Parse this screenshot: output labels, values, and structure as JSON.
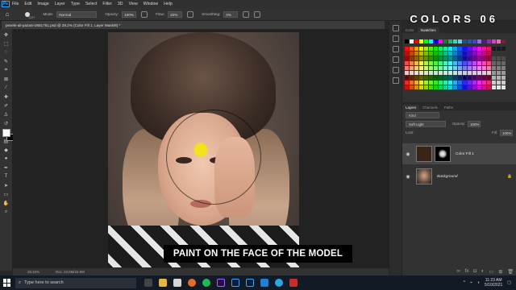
{
  "app": {
    "logo": "Ps"
  },
  "menu": [
    "File",
    "Edit",
    "Image",
    "Layer",
    "Type",
    "Select",
    "Filter",
    "3D",
    "View",
    "Window",
    "Help"
  ],
  "options": {
    "brush_size": "1227",
    "mode_label": "Mode:",
    "mode_value": "Normal",
    "opacity_label": "Opacity:",
    "opacity_value": "100%",
    "flow_label": "Flow:",
    "flow_value": "20%",
    "smoothing_label": "Smoothing:",
    "smoothing_value": "0%"
  },
  "watermark": "COLORS 06",
  "document": {
    "tab_title": "pexels-ali-pazani-2681751.psd @ 28.2% (Color Fill 1, Layer Mask/8) *",
    "zoom": "28.16%",
    "doc_size": "Doc: 22.6M/22.6M"
  },
  "subtitle": "PAINT ON THE FACE OF THE MODEL",
  "swatches_panel": {
    "tabs": [
      "Color",
      "Swatches"
    ],
    "active": "Swatches"
  },
  "layers_panel": {
    "tabs": [
      "Layers",
      "Channels",
      "Paths"
    ],
    "active": "Layers",
    "search_placeholder": "Kind",
    "blend_mode": "Soft Light",
    "opacity_label": "Opacity:",
    "opacity_value": "100%",
    "lock_label": "Lock:",
    "fill_label": "Fill:",
    "fill_value": "100%",
    "layers": [
      {
        "name": "Color Fill 1",
        "selected": true
      },
      {
        "name": "Background",
        "selected": false
      }
    ]
  },
  "taskbar": {
    "search_placeholder": "Type here to search",
    "time": "11:23 AM",
    "date": "5/10/2021"
  },
  "colors": {
    "brush_dot": "#f4e21b",
    "fill_layer": "#3a2418",
    "ps_blue": "#31a8ff"
  }
}
